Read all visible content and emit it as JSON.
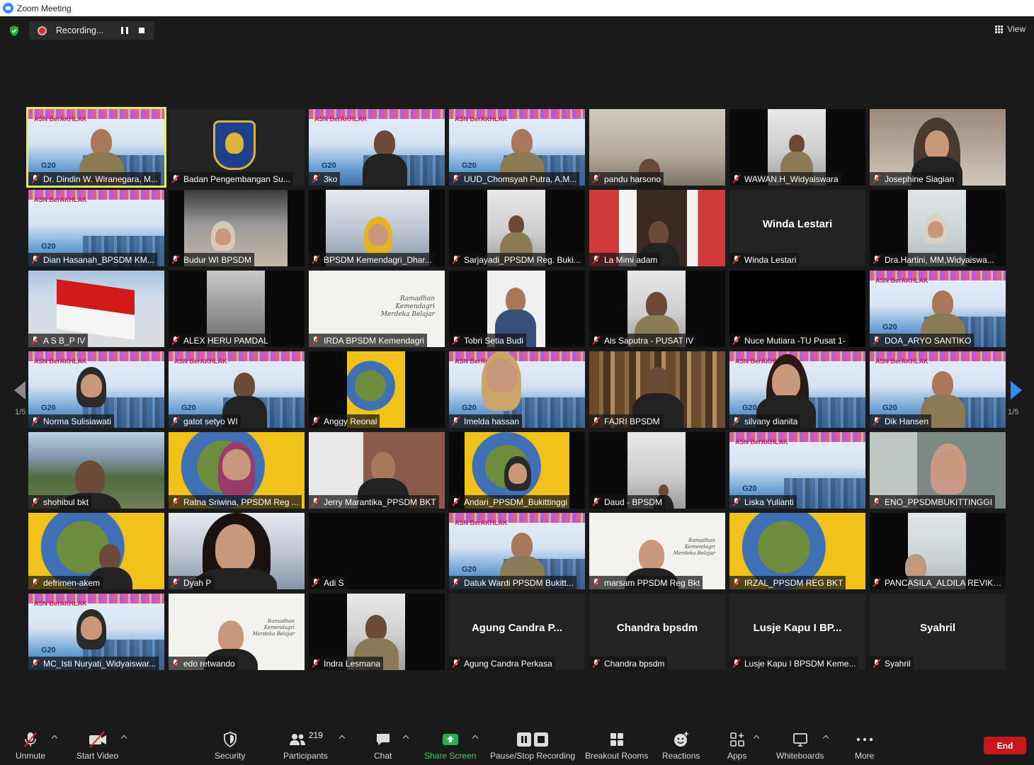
{
  "window": {
    "title": "Zoom Meeting"
  },
  "top_controls": {
    "recording_label": "Recording...",
    "view_label": "View"
  },
  "pagination": {
    "left_label": "1/5",
    "right_label": "1/5"
  },
  "participants": [
    {
      "name": "Dr. Dindin W. Wiranegara, M...",
      "active": true
    },
    {
      "name": "Badan Pengembangan Su..."
    },
    {
      "name": "3ko"
    },
    {
      "name": "UUD_Chomsyah Putra, A.M..."
    },
    {
      "name": "pandu harsono"
    },
    {
      "name": "WAWAN.H_Widyaiswara"
    },
    {
      "name": "Josephine Siagian"
    },
    {
      "name": "Dian Hasanah_BPSDM KM..."
    },
    {
      "name": "Budur WI BPSDM"
    },
    {
      "name": "BPSDM Kemendagri_Dhar..."
    },
    {
      "name": "Sarjayadi_PPSDM Reg. Buki..."
    },
    {
      "name": "La Mimi adam"
    },
    {
      "name": "Winda Lestari",
      "big_name": "Winda Lestari"
    },
    {
      "name": "Dra.Hartini, MM,Widyaiswa..."
    },
    {
      "name": "A S B_P IV"
    },
    {
      "name": "ALEX HERU PAMDAL"
    },
    {
      "name": "IRDA BPSDM Kemendagri"
    },
    {
      "name": "Tobri Setia Budi"
    },
    {
      "name": "Ais Saputra - PUSAT IV"
    },
    {
      "name": "Nuce Mutiara -TU Pusat 1-"
    },
    {
      "name": "DOA_ARYO SANTIKO"
    },
    {
      "name": "Norma Sulisiawati"
    },
    {
      "name": "gatot setyo WI"
    },
    {
      "name": "Anggy Reonal"
    },
    {
      "name": "Imelda hassan"
    },
    {
      "name": "FAJRI BPSDM"
    },
    {
      "name": "silvany dianita"
    },
    {
      "name": "Dik Hansen"
    },
    {
      "name": "shohibul bkt"
    },
    {
      "name": "Ratna Sriwina, PPSDM Reg ..."
    },
    {
      "name": "Jerry Marantika_PPSDM BKT"
    },
    {
      "name": "Andari_PPSDM_Bukittinggi"
    },
    {
      "name": "Daud - BPSDM"
    },
    {
      "name": "Liska Yulianti"
    },
    {
      "name": "ENO_PPSDMBUKITTINGGI"
    },
    {
      "name": "defrimen-akem"
    },
    {
      "name": "Dyah P"
    },
    {
      "name": "Adi S"
    },
    {
      "name": "Datuk Wardi  PPSDM Bukitt..."
    },
    {
      "name": "marsam PPSDM Reg Bkt"
    },
    {
      "name": "IRZAL_PPSDM REG BKT"
    },
    {
      "name": "PANCASILA_ALDILA REVIKA..."
    },
    {
      "name": "MC_Isti Nuryati_Widyaiswar..."
    },
    {
      "name": "edo retwando"
    },
    {
      "name": "Indra Lesmana"
    },
    {
      "name": "Agung Candra Perkasa",
      "big_name": "Agung Candra P..."
    },
    {
      "name": "Chandra bpsdm",
      "big_name": "Chandra bpsdm"
    },
    {
      "name": "Lusje Kapu I BPSDM Keme...",
      "big_name": "Lusje Kapu I BP..."
    },
    {
      "name": "Syahril",
      "big_name": "Syahril"
    }
  ],
  "banner": {
    "asn_text": "ASN BerAKHLAK",
    "g20_text": "G20"
  },
  "slide": {
    "text_line1": "Ramadhan",
    "text_line2": "Kemendagri",
    "text_line3": "Merdeka Belajar"
  },
  "toolbar": {
    "unmute": "Unmute",
    "start_video": "Start Video",
    "security": "Security",
    "participants": "Participants",
    "participants_count": "219",
    "chat": "Chat",
    "share_screen": "Share Screen",
    "pause_recording": "Pause/Stop Recording",
    "breakout_rooms": "Breakout Rooms",
    "reactions": "Reactions",
    "apps": "Apps",
    "whiteboards": "Whiteboards",
    "more": "More",
    "end": "End"
  },
  "colors": {
    "background": "#1a1a1a",
    "active_speaker": "#e6e85a",
    "share_green": "#3ecf6e",
    "end_red": "#c6171a",
    "zoom_blue": "#2d8cff"
  }
}
